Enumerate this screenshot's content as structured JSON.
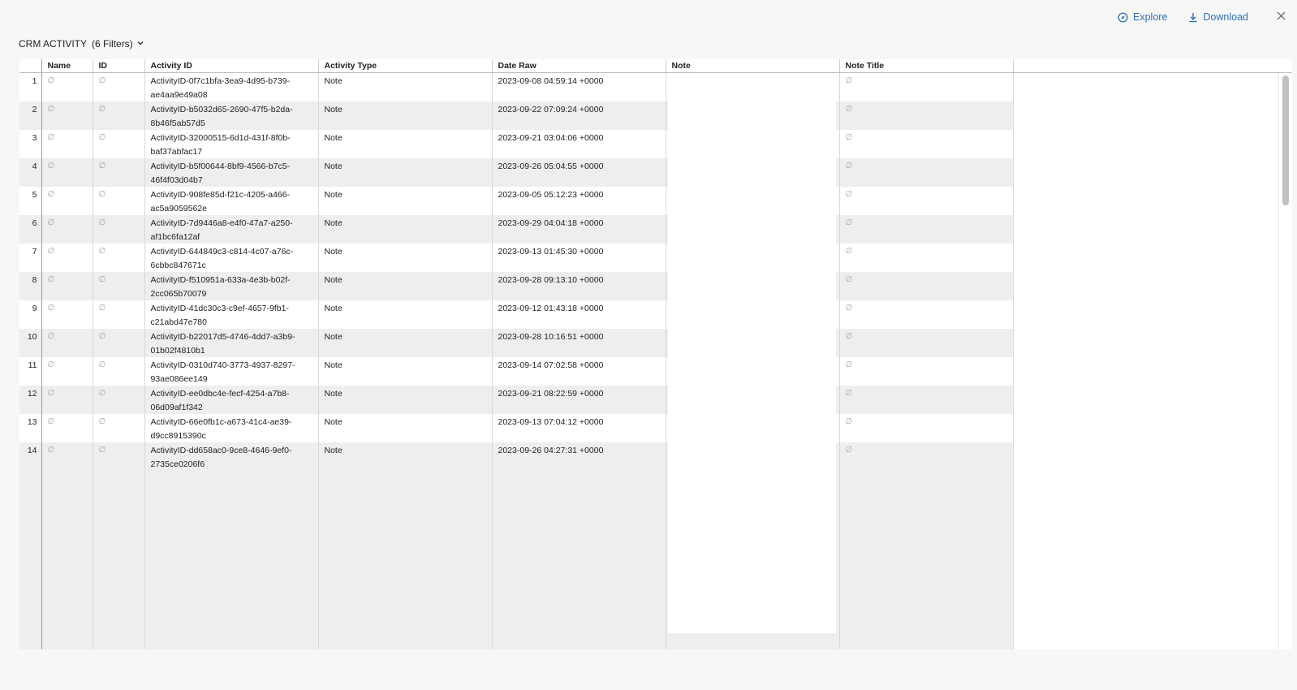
{
  "toolbar": {
    "explore_label": "Explore",
    "download_label": "Download",
    "accent_color": "#2a6ebd"
  },
  "header": {
    "title": "CRM ACTIVITY",
    "filters_label": "(6 Filters)"
  },
  "table": {
    "columns": [
      "Name",
      "ID",
      "Activity ID",
      "Activity Type",
      "Date Raw",
      "Note",
      "Note Title"
    ],
    "null_symbol": "∅",
    "rows": [
      {
        "num": "1",
        "activity_id": "ActivityID-0f7c1bfa-3ea9-4d95-b739-ae4aa9e49a08",
        "activity_type": "Note",
        "date_raw": "2023-09-08 04:59:14 +0000"
      },
      {
        "num": "2",
        "activity_id": "ActivityID-b5032d65-2690-47f5-b2da-8b46f5ab57d5",
        "activity_type": "Note",
        "date_raw": "2023-09-22 07:09:24 +0000"
      },
      {
        "num": "3",
        "activity_id": "ActivityID-32000515-6d1d-431f-8f0b-baf37abfac17",
        "activity_type": "Note",
        "date_raw": "2023-09-21 03:04:06 +0000"
      },
      {
        "num": "4",
        "activity_id": "ActivityID-b5f00644-8bf9-4566-b7c5-46f4f03d04b7",
        "activity_type": "Note",
        "date_raw": "2023-09-26 05:04:55 +0000"
      },
      {
        "num": "5",
        "activity_id": "ActivityID-908fe85d-f21c-4205-a466-ac5a9059562e",
        "activity_type": "Note",
        "date_raw": "2023-09-05 05:12:23 +0000"
      },
      {
        "num": "6",
        "activity_id": "ActivityID-7d9446a8-e4f0-47a7-a250-af1bc6fa12af",
        "activity_type": "Note",
        "date_raw": "2023-09-29 04:04:18 +0000"
      },
      {
        "num": "7",
        "activity_id": "ActivityID-644849c3-c814-4c07-a76c-6cbbc847671c",
        "activity_type": "Note",
        "date_raw": "2023-09-13 01:45:30 +0000"
      },
      {
        "num": "8",
        "activity_id": "ActivityID-f510951a-633a-4e3b-b02f-2cc065b70079",
        "activity_type": "Note",
        "date_raw": "2023-09-28 09:13:10 +0000"
      },
      {
        "num": "9",
        "activity_id": "ActivityID-41dc30c3-c9ef-4657-9fb1-c21abd47e780",
        "activity_type": "Note",
        "date_raw": "2023-09-12 01:43:18 +0000"
      },
      {
        "num": "10",
        "activity_id": "ActivityID-b22017d5-4746-4dd7-a3b9-01b02f4810b1",
        "activity_type": "Note",
        "date_raw": "2023-09-28 10:16:51 +0000"
      },
      {
        "num": "11",
        "activity_id": "ActivityID-0310d740-3773-4937-8297-93ae086ee149",
        "activity_type": "Note",
        "date_raw": "2023-09-14 07:02:58 +0000"
      },
      {
        "num": "12",
        "activity_id": "ActivityID-ee0dbc4e-fecf-4254-a7b8-06d09af1f342",
        "activity_type": "Note",
        "date_raw": "2023-09-21 08:22:59 +0000"
      },
      {
        "num": "13",
        "activity_id": "ActivityID-66e0fb1c-a673-41c4-ae39-d9cc8915390c",
        "activity_type": "Note",
        "date_raw": "2023-09-13 07:04:12 +0000"
      },
      {
        "num": "14",
        "activity_id": "ActivityID-dd658ac0-9ce8-4646-9ef0-2735ce0206f6",
        "activity_type": "Note",
        "date_raw": "2023-09-26 04:27:31 +0000"
      }
    ]
  }
}
